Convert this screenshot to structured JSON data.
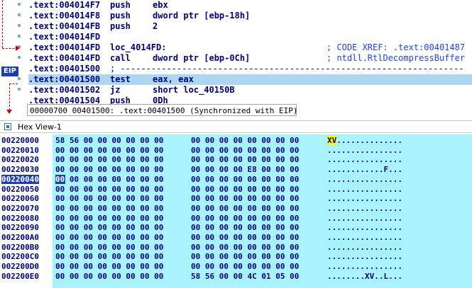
{
  "disassembly": {
    "lines": [
      {
        "addr": ".text:004014F7",
        "mnem": "push",
        "ops": "ebx",
        "comment": ""
      },
      {
        "addr": ".text:004014F8",
        "mnem": "push",
        "ops": "dword ptr [ebp-18h]",
        "comment": ""
      },
      {
        "addr": ".text:004014FB",
        "mnem": "push",
        "ops": "2",
        "comment": ""
      },
      {
        "addr": ".text:004014FD",
        "mnem": "",
        "ops": "",
        "comment": ""
      },
      {
        "addr": ".text:004014FD",
        "mnem": "loc_4014FD:",
        "ops": "",
        "comment": "; CODE XREF: .text:00401487"
      },
      {
        "addr": ".text:004014FD",
        "mnem": "call",
        "ops": "dword ptr [ebp-0Ch]",
        "comment": "; ntdll.RtlDecompressBuffer"
      },
      {
        "addr": ".text:00401500",
        "mnem": "; -------------------------------------------------------------------",
        "ops": "",
        "comment": ""
      },
      {
        "addr": ".text:00401500",
        "mnem": "test",
        "ops": "eax, eax",
        "comment": ""
      },
      {
        "addr": ".text:00401502",
        "mnem": "jz",
        "ops": "short loc_40150B",
        "comment": ""
      },
      {
        "addr": ".text:00401504",
        "mnem": "push",
        "ops": "0Dh",
        "comment": ""
      }
    ],
    "eip_label": "EIP",
    "status": "00000700 00401500: .text:00401500 (Synchronized with EIP)"
  },
  "hex_view": {
    "title": "Hex View-1",
    "rows": [
      {
        "addr": "00220000",
        "b1": "58 56 00 00 00 00 00 00",
        "b2": "00 00 00 00 00 00 00 00",
        "ascii_hl": "XV",
        "ascii": ".............."
      },
      {
        "addr": "00220010",
        "b1": "00 00 00 00 00 00 00 00",
        "b2": "00 00 00 00 00 00 00 00",
        "ascii_hl": "",
        "ascii": "................"
      },
      {
        "addr": "00220020",
        "b1": "00 00 00 00 00 00 00 00",
        "b2": "00 00 00 00 00 00 00 00",
        "ascii_hl": "",
        "ascii": "................"
      },
      {
        "addr": "00220030",
        "b1": "00 00 00 00 00 00 00 00",
        "b2": "00 00 00 00 E8 00 00 00",
        "ascii_hl": "",
        "ascii": "............F..."
      },
      {
        "addr": "00220040",
        "b1": "00 00 00 00 00 00 00 00",
        "b2": "00 00 00 00 00 00 00 00",
        "ascii_hl": "",
        "ascii": "................"
      },
      {
        "addr": "00220050",
        "b1": "00 00 00 00 00 00 00 00",
        "b2": "00 00 00 00 00 00 00 00",
        "ascii_hl": "",
        "ascii": "................"
      },
      {
        "addr": "00220060",
        "b1": "00 00 00 00 00 00 00 00",
        "b2": "00 00 00 00 00 00 00 00",
        "ascii_hl": "",
        "ascii": "................"
      },
      {
        "addr": "00220070",
        "b1": "00 00 00 00 00 00 00 00",
        "b2": "00 00 00 00 00 00 00 00",
        "ascii_hl": "",
        "ascii": "................"
      },
      {
        "addr": "00220080",
        "b1": "00 00 00 00 00 00 00 00",
        "b2": "00 00 00 00 00 00 00 00",
        "ascii_hl": "",
        "ascii": "................"
      },
      {
        "addr": "00220090",
        "b1": "00 00 00 00 00 00 00 00",
        "b2": "00 00 00 00 00 00 00 00",
        "ascii_hl": "",
        "ascii": "................"
      },
      {
        "addr": "002200A0",
        "b1": "00 00 00 00 00 00 00 00",
        "b2": "00 00 00 00 00 00 00 00",
        "ascii_hl": "",
        "ascii": "................"
      },
      {
        "addr": "002200B0",
        "b1": "00 00 00 00 00 00 00 00",
        "b2": "00 00 00 00 00 00 00 00",
        "ascii_hl": "",
        "ascii": "................"
      },
      {
        "addr": "002200C0",
        "b1": "00 00 00 00 00 00 00 00",
        "b2": "00 00 00 00 00 00 00 00",
        "ascii_hl": "",
        "ascii": "................"
      },
      {
        "addr": "002200D0",
        "b1": "00 00 00 00 00 00 00 00",
        "b2": "00 00 00 00 00 00 00 00",
        "ascii_hl": "",
        "ascii": "................"
      },
      {
        "addr": "002200E0",
        "b1": "00 00 00 00 00 00 00 00",
        "b2": "58 56 00 00 4C 01 05 00",
        "ascii_hl": "",
        "ascii": "........XV..L..."
      }
    ],
    "current_addr": "00220040",
    "cursor_byte": "00"
  },
  "colors": {
    "eip_badge": "#1c3fb0",
    "highlight_line": "#aed6f1",
    "hex_background": "#a9f2ff",
    "ascii_highlight": "#ffff00"
  }
}
